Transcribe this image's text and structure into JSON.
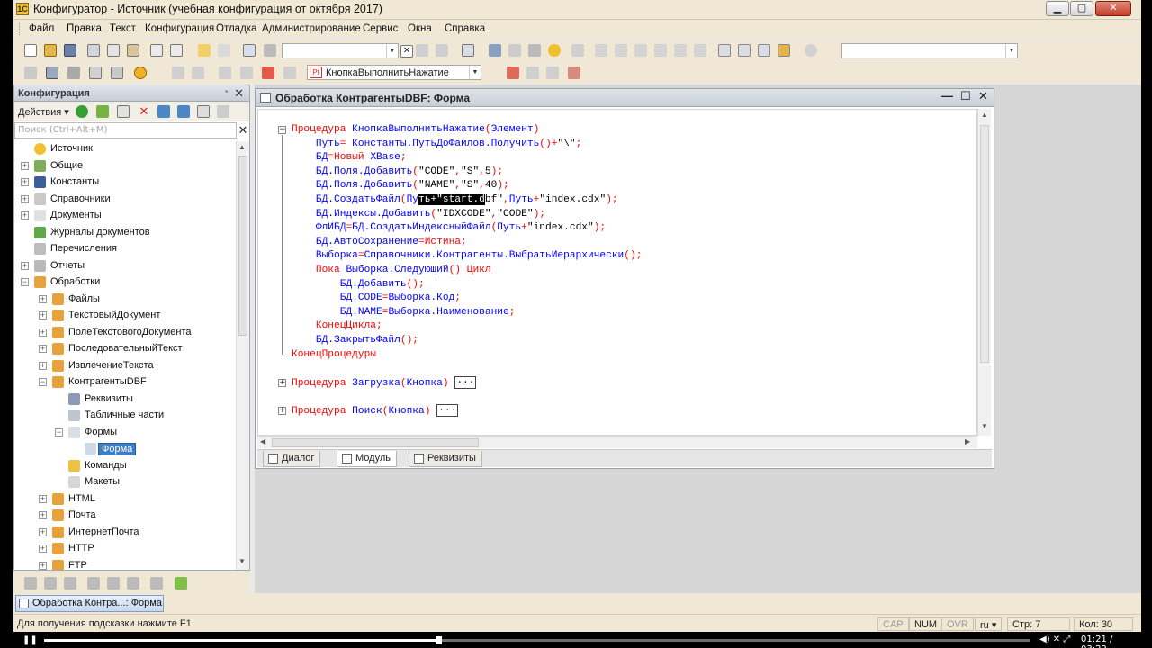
{
  "window": {
    "title": "Конфигуратор - Источник (учебная конфигурация от октября 2017)",
    "app_icon_letter": "1C",
    "min": "▁",
    "max": "▢",
    "close": "✕"
  },
  "menu": [
    "Файл",
    "Правка",
    "Текст",
    "Конфигурация",
    "Отладка",
    "Администрирование",
    "Сервис",
    "Окна",
    "Справка"
  ],
  "toolbar": {
    "procedure_select": "КнопкаВыполнитьНажатие",
    "procedure_icon": "Pt",
    "search_value": ""
  },
  "left_panel": {
    "title": "Конфигурация",
    "pin": "▪",
    "close": "✕",
    "actions_label": "Действия",
    "search_placeholder": "Поиск (Ctrl+Alt+M)",
    "search_clear": "✕",
    "tree": [
      {
        "label": "Источник",
        "level": 0,
        "toggle": "",
        "icon": "root"
      },
      {
        "label": "Общие",
        "level": 0,
        "toggle": "+",
        "icon": "common"
      },
      {
        "label": "Константы",
        "level": 0,
        "toggle": "+",
        "icon": "const"
      },
      {
        "label": "Справочники",
        "level": 0,
        "toggle": "+",
        "icon": "catalog"
      },
      {
        "label": "Документы",
        "level": 0,
        "toggle": "+",
        "icon": "doc"
      },
      {
        "label": "Журналы документов",
        "level": 0,
        "toggle": "",
        "icon": "journal"
      },
      {
        "label": "Перечисления",
        "level": 0,
        "toggle": "",
        "icon": "enum"
      },
      {
        "label": "Отчеты",
        "level": 0,
        "toggle": "+",
        "icon": "report"
      },
      {
        "label": "Обработки",
        "level": 0,
        "toggle": "−",
        "icon": "proc"
      },
      {
        "label": "Файлы",
        "level": 1,
        "toggle": "+",
        "icon": "proc"
      },
      {
        "label": "ТекстовыйДокумент",
        "level": 1,
        "toggle": "+",
        "icon": "proc"
      },
      {
        "label": "ПолеТекстовогоДокумента",
        "level": 1,
        "toggle": "+",
        "icon": "proc"
      },
      {
        "label": "ПоследовательныйТекст",
        "level": 1,
        "toggle": "+",
        "icon": "proc"
      },
      {
        "label": "ИзвлечениеТекста",
        "level": 1,
        "toggle": "+",
        "icon": "proc"
      },
      {
        "label": "КонтрагентыDBF",
        "level": 1,
        "toggle": "−",
        "icon": "proc"
      },
      {
        "label": "Реквизиты",
        "level": 2,
        "toggle": "",
        "icon": "attr"
      },
      {
        "label": "Табличные части",
        "level": 2,
        "toggle": "",
        "icon": "table"
      },
      {
        "label": "Формы",
        "level": 2,
        "toggle": "−",
        "icon": "forms"
      },
      {
        "label": "Форма",
        "level": 3,
        "toggle": "",
        "icon": "form",
        "selected": true
      },
      {
        "label": "Команды",
        "level": 2,
        "toggle": "",
        "icon": "cmd"
      },
      {
        "label": "Макеты",
        "level": 2,
        "toggle": "",
        "icon": "layout"
      },
      {
        "label": "HTML",
        "level": 1,
        "toggle": "+",
        "icon": "proc"
      },
      {
        "label": "Почта",
        "level": 1,
        "toggle": "+",
        "icon": "proc"
      },
      {
        "label": "ИнтернетПочта",
        "level": 1,
        "toggle": "+",
        "icon": "proc"
      },
      {
        "label": "HTTP",
        "level": 1,
        "toggle": "+",
        "icon": "proc"
      },
      {
        "label": "FTP",
        "level": 1,
        "toggle": "+",
        "icon": "proc"
      }
    ]
  },
  "form_window": {
    "title": "Обработка КонтрагентыDBF: Форма",
    "controls": {
      "min": "—",
      "max": "☐",
      "close": "✕"
    },
    "tabs": [
      "Диалог",
      "Модуль",
      "Реквизиты"
    ],
    "active_tab": "Модуль",
    "code": [
      [
        [
          "kw",
          "Процедура "
        ],
        [
          "id",
          "КнопкаВыполнитьНажатие"
        ],
        [
          "pn",
          "("
        ],
        [
          "id",
          "Элемент"
        ],
        [
          "pn",
          ")"
        ]
      ],
      [
        [
          "st",
          "    "
        ],
        [
          "id",
          "Путь"
        ],
        [
          "pn",
          "= "
        ],
        [
          "id",
          "Константы.ПутьДоФайлов.Получить"
        ],
        [
          "pn",
          "()+"
        ],
        [
          "st",
          "\"\\\""
        ],
        [
          "pn",
          ";"
        ]
      ],
      [
        [
          "st",
          "    "
        ],
        [
          "id",
          "БД"
        ],
        [
          "pn",
          "="
        ],
        [
          "kw",
          "Новый "
        ],
        [
          "id",
          "XBase"
        ],
        [
          "pn",
          ";"
        ]
      ],
      [
        [
          "st",
          "    "
        ],
        [
          "id",
          "БД.Поля.Добавить"
        ],
        [
          "pn",
          "("
        ],
        [
          "st",
          "\"CODE\""
        ],
        [
          "pn",
          ","
        ],
        [
          "st",
          "\"S\""
        ],
        [
          "pn",
          ","
        ],
        [
          "st",
          "5"
        ],
        [
          "pn",
          ");"
        ]
      ],
      [
        [
          "st",
          "    "
        ],
        [
          "id",
          "БД.Поля.Добавить"
        ],
        [
          "pn",
          "("
        ],
        [
          "st",
          "\"NAME\""
        ],
        [
          "pn",
          ","
        ],
        [
          "st",
          "\"S\""
        ],
        [
          "pn",
          ","
        ],
        [
          "st",
          "40"
        ],
        [
          "pn",
          ");"
        ]
      ],
      [
        [
          "st",
          "    "
        ],
        [
          "id",
          "БД.СоздатьФайл"
        ],
        [
          "pn",
          "("
        ],
        [
          "id",
          "Пу"
        ],
        [
          "hl",
          "ть+\"start.d"
        ],
        [
          "st",
          "bf\""
        ],
        [
          "pn",
          ","
        ],
        [
          "id",
          "Путь"
        ],
        [
          "pn",
          "+"
        ],
        [
          "st",
          "\"index.cdx\""
        ],
        [
          "pn",
          ");"
        ]
      ],
      [
        [
          "st",
          "    "
        ],
        [
          "id",
          "БД.Индексы.Добавить"
        ],
        [
          "pn",
          "("
        ],
        [
          "st",
          "\"IDXCODE\""
        ],
        [
          "pn",
          ","
        ],
        [
          "st",
          "\"CODE\""
        ],
        [
          "pn",
          ");"
        ]
      ],
      [
        [
          "st",
          "    "
        ],
        [
          "id",
          "ФлИБД"
        ],
        [
          "pn",
          "="
        ],
        [
          "id",
          "БД.СоздатьИндексныйФайл"
        ],
        [
          "pn",
          "("
        ],
        [
          "id",
          "Путь"
        ],
        [
          "pn",
          "+"
        ],
        [
          "st",
          "\"index.cdx\""
        ],
        [
          "pn",
          ");"
        ]
      ],
      [
        [
          "st",
          "    "
        ],
        [
          "id",
          "БД.АвтоСохранение"
        ],
        [
          "pn",
          "="
        ],
        [
          "kw",
          "Истина"
        ],
        [
          "pn",
          ";"
        ]
      ],
      [
        [
          "st",
          "    "
        ],
        [
          "id",
          "Выборка"
        ],
        [
          "pn",
          "="
        ],
        [
          "id",
          "Справочники.Контрагенты.ВыбратьИерархически"
        ],
        [
          "pn",
          "();"
        ]
      ],
      [
        [
          "st",
          "    "
        ],
        [
          "kw",
          "Пока "
        ],
        [
          "id",
          "Выборка.Следующий"
        ],
        [
          "pn",
          "() "
        ],
        [
          "kw",
          "Цикл"
        ]
      ],
      [
        [
          "st",
          "        "
        ],
        [
          "id",
          "БД.Добавить"
        ],
        [
          "pn",
          "();"
        ]
      ],
      [
        [
          "st",
          "        "
        ],
        [
          "id",
          "БД.CODE"
        ],
        [
          "pn",
          "="
        ],
        [
          "id",
          "Выборка.Код"
        ],
        [
          "pn",
          ";"
        ]
      ],
      [
        [
          "st",
          "        "
        ],
        [
          "id",
          "БД.NAME"
        ],
        [
          "pn",
          "="
        ],
        [
          "id",
          "Выборка.Наименование"
        ],
        [
          "pn",
          ";"
        ]
      ],
      [
        [
          "st",
          "    "
        ],
        [
          "kw",
          "КонецЦикла"
        ],
        [
          "pn",
          ";"
        ]
      ],
      [
        [
          "st",
          "    "
        ],
        [
          "id",
          "БД.ЗакрытьФайл"
        ],
        [
          "pn",
          "();"
        ]
      ],
      [
        [
          "kw",
          "КонецПроцедуры"
        ]
      ],
      [],
      [
        [
          "kw",
          "Процедура "
        ],
        [
          "id",
          "Загрузка"
        ],
        [
          "pn",
          "("
        ],
        [
          "id",
          "Кнопка"
        ],
        [
          "pn",
          ") "
        ],
        [
          "dots",
          "..."
        ]
      ],
      [],
      [
        [
          "kw",
          "Процедура "
        ],
        [
          "id",
          "Поиск"
        ],
        [
          "pn",
          "("
        ],
        [
          "id",
          "Кнопка"
        ],
        [
          "pn",
          ") "
        ],
        [
          "dots",
          "..."
        ]
      ]
    ]
  },
  "taskbar": {
    "item": "Обработка Контра...: Форма"
  },
  "statusbar": {
    "hint": "Для получения подсказки нажмите F1",
    "cap": "CAP",
    "num": "NUM",
    "ovr": "OVR",
    "lang": "ru ▾",
    "line": "Стр: 7",
    "col": "Кол: 30"
  },
  "player": {
    "time": "01:21 / 03:22",
    "controls": "◀) ✕ ⤢",
    "progress": 0.4
  },
  "colors": {
    "keyword": "#ff0000",
    "identifier": "#0000ff",
    "selection": "#000000",
    "tree_selection": "#3d7ec9",
    "chrome": "#f0e8d4"
  }
}
